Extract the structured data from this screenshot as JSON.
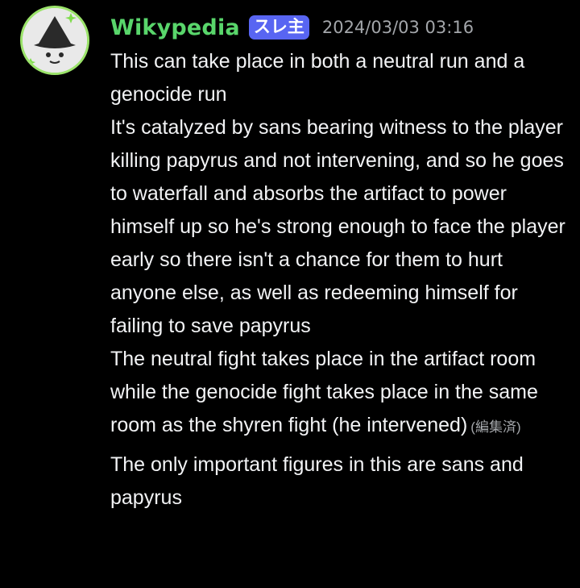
{
  "author": {
    "name": "Wikypedia",
    "badge": "スレ主",
    "timestamp": "2024/03/03 03:16",
    "accent_color": "#59d66b",
    "badge_color": "#5865f2",
    "avatar_icon": "avatar-wizard-hat-icon"
  },
  "message": {
    "paragraph_1": "This can take place in both a neutral run and a genocide run",
    "paragraph_2": "It's catalyzed by sans bearing witness to the player killing papyrus and not intervening, and so he goes to waterfall and absorbs the artifact to power himself up so he's strong enough to face the player early so there isn't a chance for them to hurt anyone else, as well as redeeming himself for failing to save papyrus",
    "paragraph_3": "The neutral fight takes place in the artifact room while the genocide fight takes place in the same room as the shyren fight (he intervened)",
    "edited_label": "(編集済)",
    "follow_up": "The only important figures in this are sans and papyrus"
  }
}
